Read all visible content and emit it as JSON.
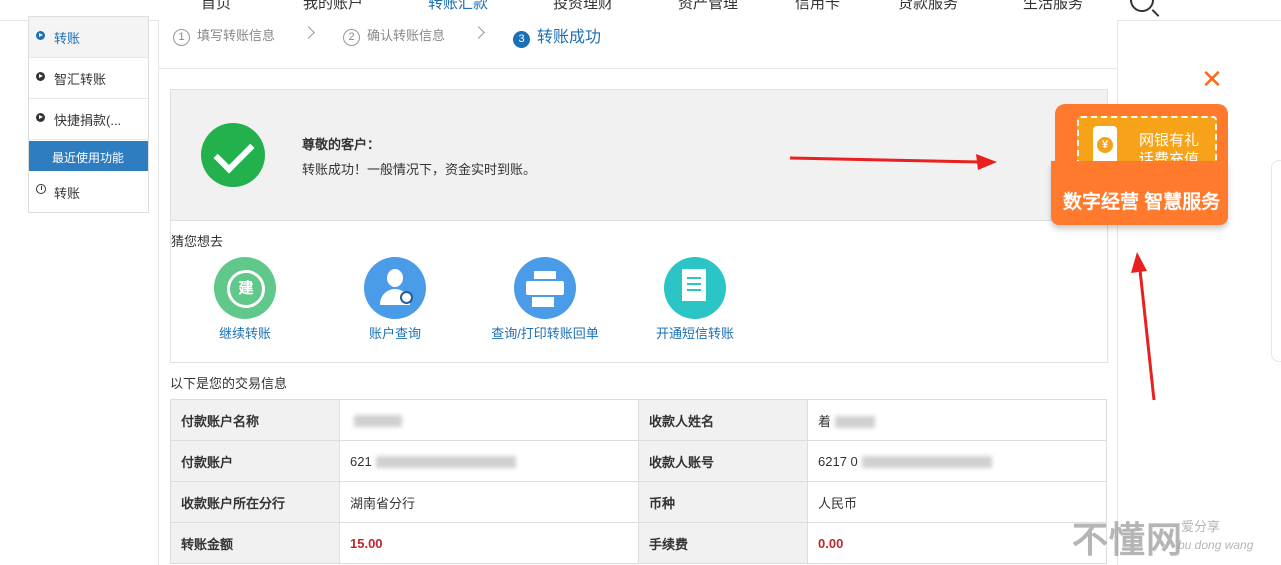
{
  "nav": {
    "items": [
      "首页",
      "我的账户",
      "转账汇款",
      "投资理财",
      "资产管理",
      "信用卡",
      "贷款服务",
      "生活服务"
    ],
    "active": "转账汇款"
  },
  "sidebar": {
    "items": [
      {
        "label": "转账",
        "active": true
      },
      {
        "label": "智汇转账"
      },
      {
        "label": "快捷捐款(..."
      }
    ],
    "recent_header": "最近使用功能",
    "recent_items": [
      {
        "label": "转账"
      }
    ]
  },
  "steps": [
    {
      "num": "1",
      "label": "填写转账信息"
    },
    {
      "num": "2",
      "label": "确认转账信息"
    },
    {
      "num": "3",
      "label": "转账成功",
      "active": true
    }
  ],
  "success": {
    "greeting": "尊敬的客户：",
    "message": "转账成功！一般情况下，资金实时到账。"
  },
  "guess": {
    "title": "猜您想去",
    "items": [
      {
        "label": "继续转账",
        "icon": "continue-transfer-icon",
        "icon_text": "建"
      },
      {
        "label": "账户查询",
        "icon": "account-query-icon"
      },
      {
        "label": "查询/打印转账回单",
        "icon": "printer-icon"
      },
      {
        "label": "开通短信转账",
        "icon": "sms-transfer-icon"
      }
    ]
  },
  "transaction": {
    "title": "以下是您的交易信息",
    "rows": [
      {
        "k1": "付款账户名称",
        "v1": "",
        "k2": "收款人姓名",
        "v2": "着"
      },
      {
        "k1": "付款账户",
        "v1": "621",
        "k2": "收款人账号",
        "v2": "6217 0"
      },
      {
        "k1": "收款账户所在分行",
        "v1": "湖南省分行",
        "k2": "币种",
        "v2": "人民币"
      },
      {
        "k1": "转账金额",
        "v1": "15.00",
        "k2": "手续费",
        "v2": "0.00"
      }
    ]
  },
  "promo": {
    "line1": "网银有礼",
    "line2": "话费充值",
    "band": "数字经营 智慧服务",
    "close": "✕"
  },
  "watermark": {
    "big": "不懂网",
    "small1": "爱分享",
    "small2": "bu dong wang"
  },
  "colors": {
    "accent": "#1a6fb5",
    "success": "#22b14c",
    "promo": "#ff7a2c",
    "amount": "#c0262d",
    "arrow": "#e8201e"
  }
}
